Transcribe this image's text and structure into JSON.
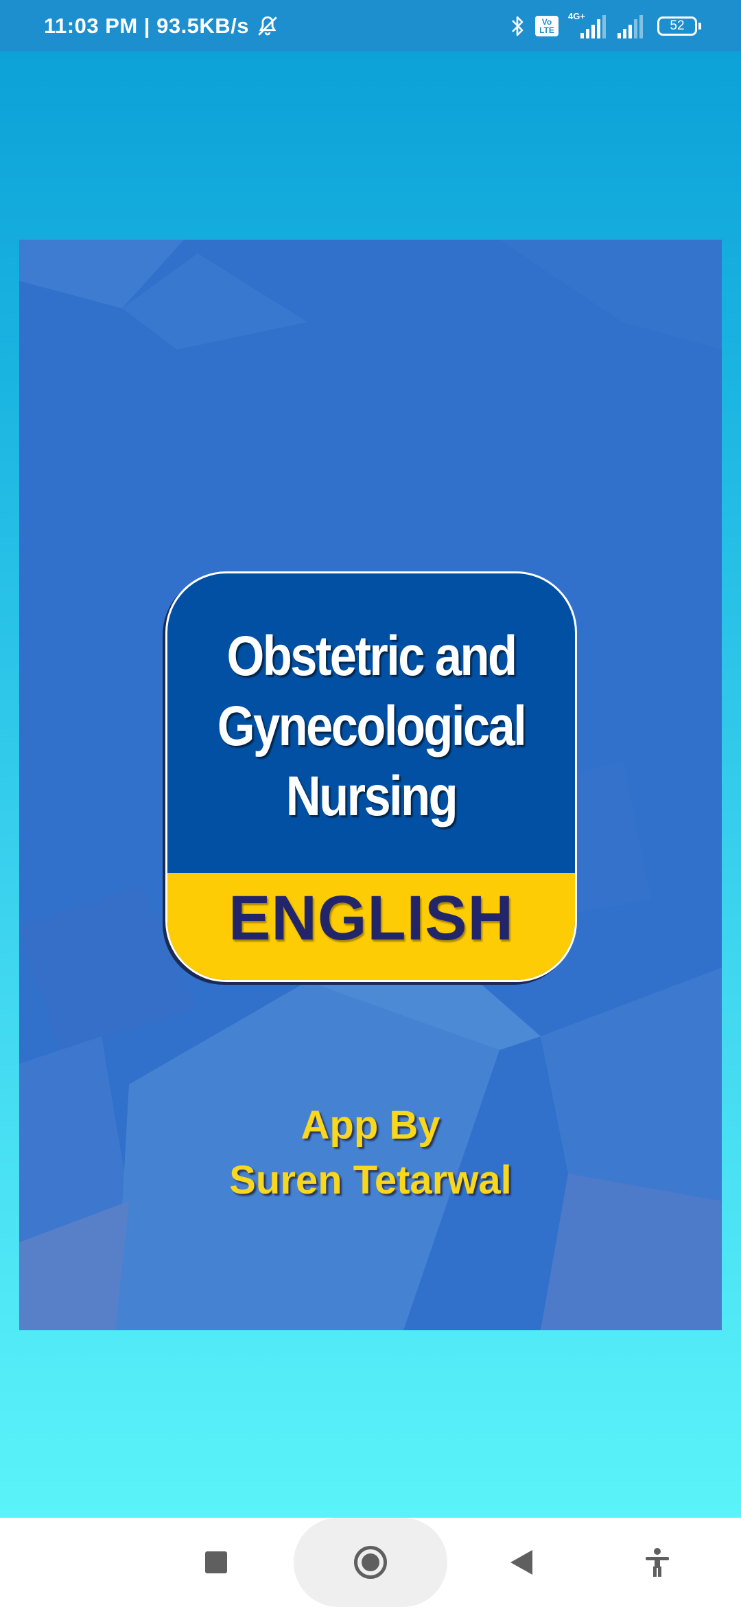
{
  "status_bar": {
    "time_speed": "11:03 PM | 93.5KB/s",
    "volte_label": "Vo LTE",
    "network_label": "4G+",
    "battery": "52",
    "icons": [
      "bell-off-icon",
      "bluetooth-icon",
      "volte-icon",
      "signal-icon",
      "signal-icon",
      "battery-icon"
    ]
  },
  "splash": {
    "logo_title_line1": "Obstetric and",
    "logo_title_line2": "Gynecological",
    "logo_title_line3": "Nursing",
    "logo_band": "ENGLISH",
    "credit_line1": "App By",
    "credit_line2": "Suren Tetarwal"
  },
  "nav_bar": {
    "icons": [
      "recents-icon",
      "home-icon",
      "back-icon",
      "accessibility-icon"
    ]
  },
  "colors": {
    "status_bar": "#1d8fce",
    "splash_bg": "#3171cc",
    "logo_blue": "#0250a3",
    "logo_band": "#fecc04",
    "logo_band_text": "#23256b",
    "credit_text": "#f9d71c"
  }
}
